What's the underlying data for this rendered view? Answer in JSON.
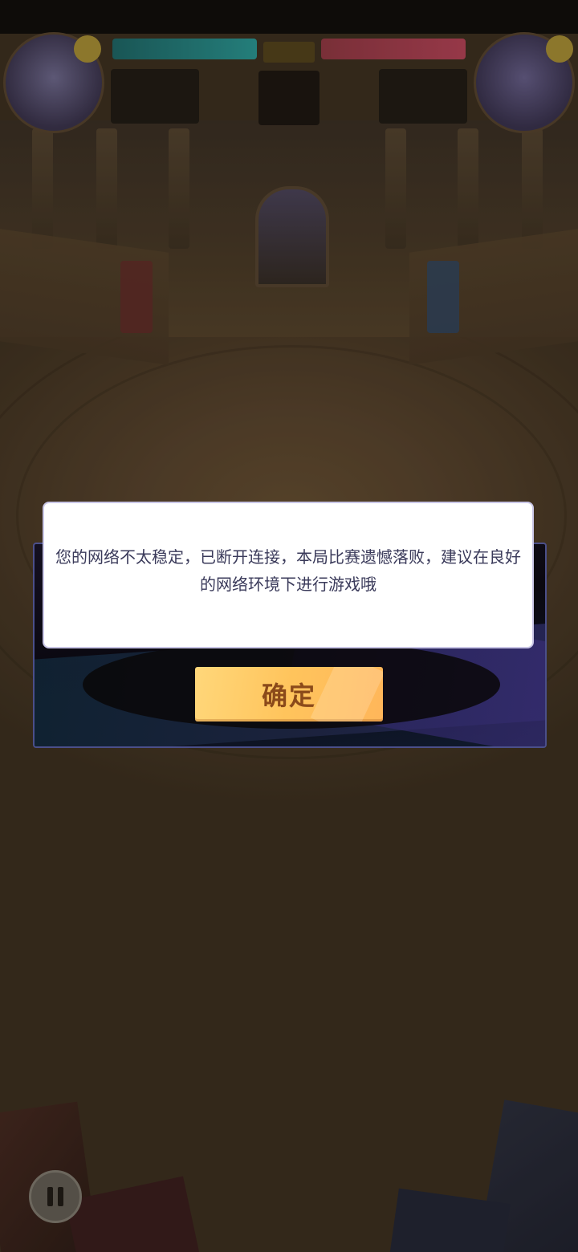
{
  "dialog": {
    "message": "您的网络不太稳定，已断开连接，本局比赛遗憾落败，建议在良好的网络环境下进行游戏哦",
    "confirm_label": "确定"
  },
  "colors": {
    "confirm_button": "#ffc45c",
    "confirm_text": "#8b4a1a",
    "panel_border": "#4b4f8a",
    "player_hp": "#2aa3a1",
    "opponent_hp": "#c2465e"
  }
}
